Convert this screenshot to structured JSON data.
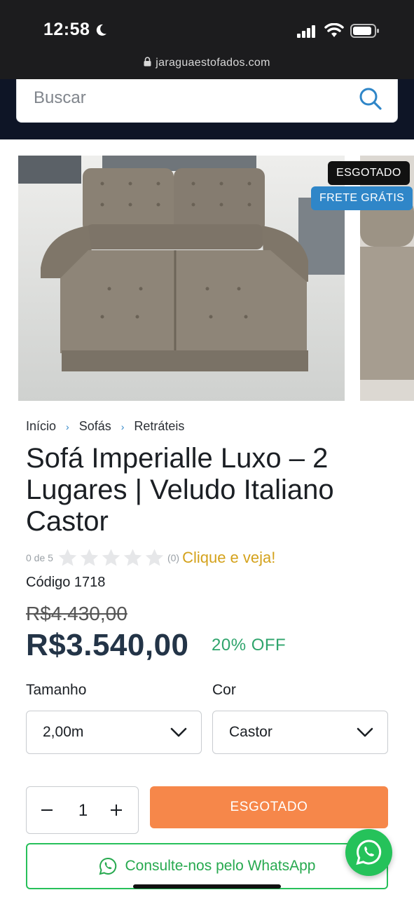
{
  "status_bar": {
    "time": "12:58",
    "url": "jaraguaestofados.com"
  },
  "search": {
    "placeholder": "Buscar"
  },
  "badges": {
    "sold_out": "ESGOTADO",
    "free_shipping": "FRETE GRÁTIS"
  },
  "breadcrumb": [
    "Início",
    "Sofás",
    "Retráteis"
  ],
  "product": {
    "title": "Sofá Imperialle Luxo – 2 Lugares | Veludo Italiano Castor",
    "rating_score": "0 de 5",
    "rating_stars": 0,
    "rating_count": "(0)",
    "rating_cta": "Clique e veja!",
    "code": "Código 1718",
    "old_price": "R$4.430,00",
    "price": "R$3.540,00",
    "discount": "20% OFF"
  },
  "options": {
    "size_label": "Tamanho",
    "size_value": "2,00m",
    "color_label": "Cor",
    "color_value": "Castor"
  },
  "purchase": {
    "quantity": "1",
    "buy_label": "ESGOTADO",
    "whatsapp_label": "Consulte-nos pelo WhatsApp"
  },
  "colors": {
    "header_bg": "#0e1526",
    "accent_blue": "#2f86c8",
    "buy_orange": "#f6874a",
    "whatsapp_green": "#25c25a",
    "price_navy": "#233447",
    "discount_green": "#2fa46c",
    "rating_gold": "#d4a21c"
  }
}
